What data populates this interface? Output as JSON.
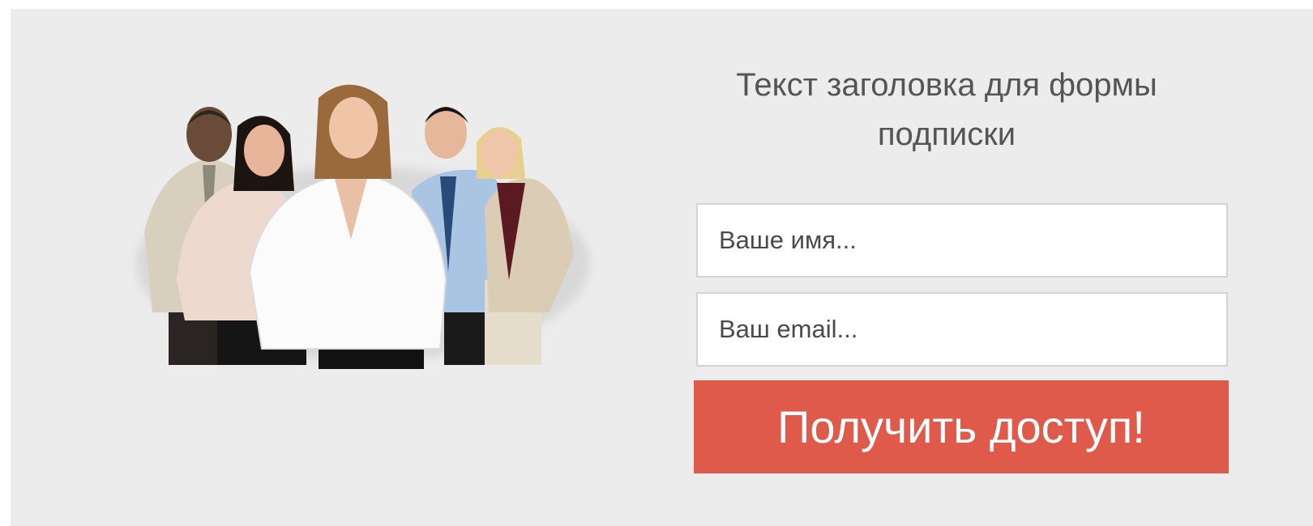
{
  "form": {
    "headline_line1": "Текст заголовка для формы",
    "headline_line2": "подписки",
    "name_placeholder": "Ваше имя...",
    "email_placeholder": "Ваш email...",
    "submit_label": "Получить доступ!"
  },
  "colors": {
    "panel_background": "#ececec",
    "button_background": "#e05a4c",
    "button_text": "#ffffff",
    "headline_text": "#555555"
  },
  "image": {
    "icon": "business-team-photo"
  }
}
